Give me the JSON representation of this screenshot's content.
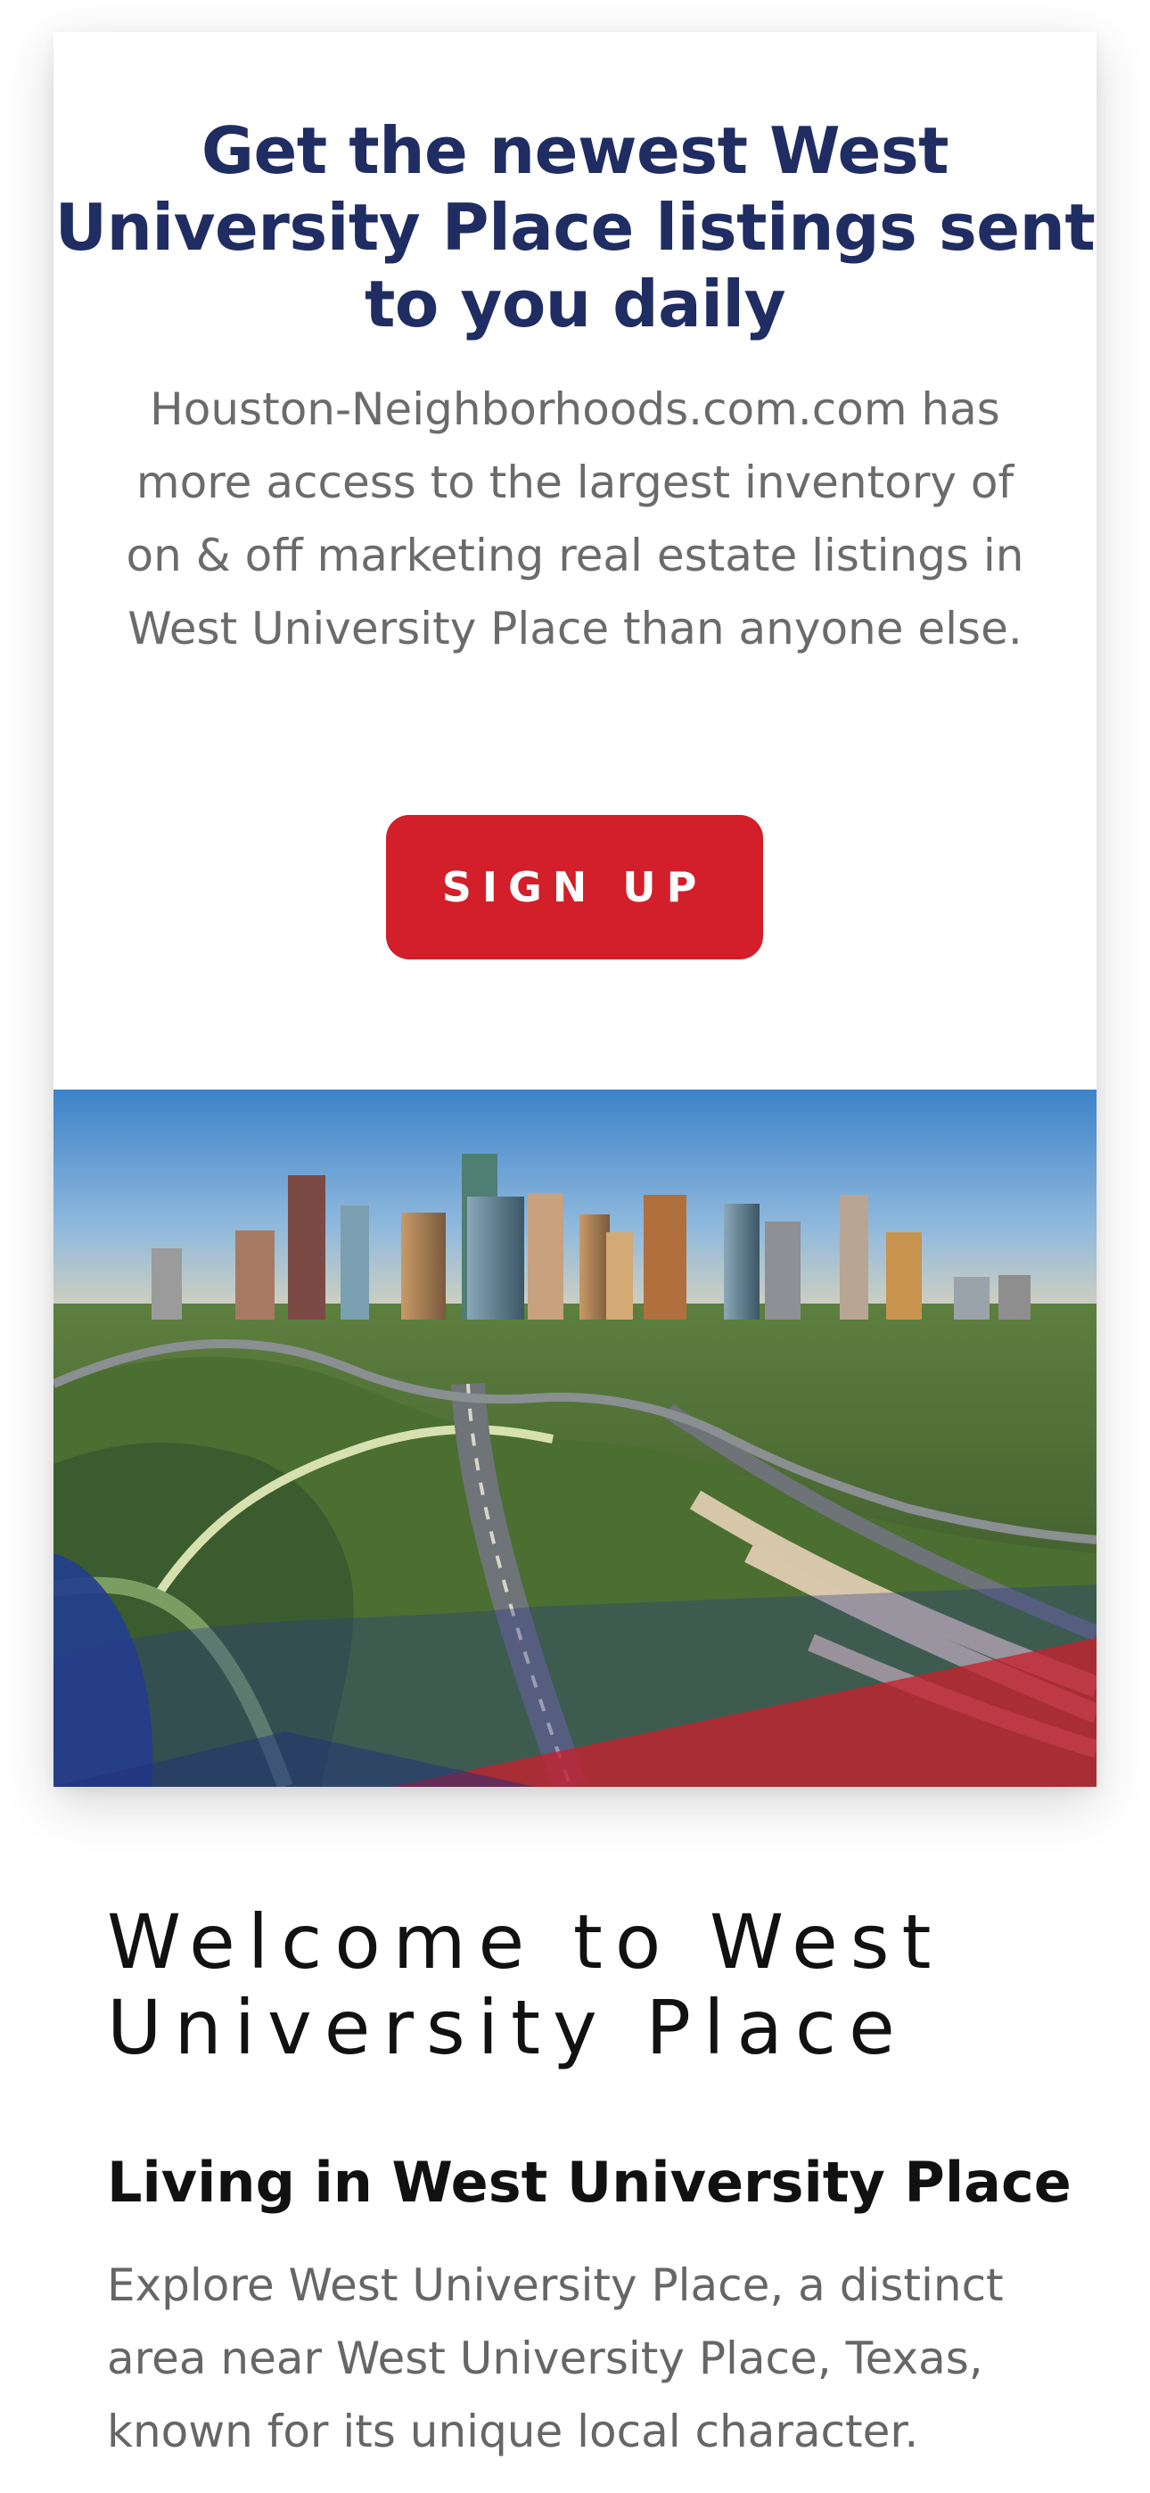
{
  "signup_card": {
    "title": "Get the newest West University Place listings sent to you daily",
    "description": "Houston-Neighborhoods.com.com has more access to the largest inventory of on & off marketing real estate listings in West University Place than anyone else.",
    "button_label": "SIGN UP",
    "accent_color": "#d21f2a",
    "title_color": "#1f2d63"
  },
  "hero_image": {
    "alt": "Houston skyline aerial view"
  },
  "welcome": {
    "title": "Welcome to West University Place",
    "subheading": "Living in West University Place",
    "body": "Explore West University Place, a distinct area near West University Place, Texas, known for its unique local character."
  }
}
